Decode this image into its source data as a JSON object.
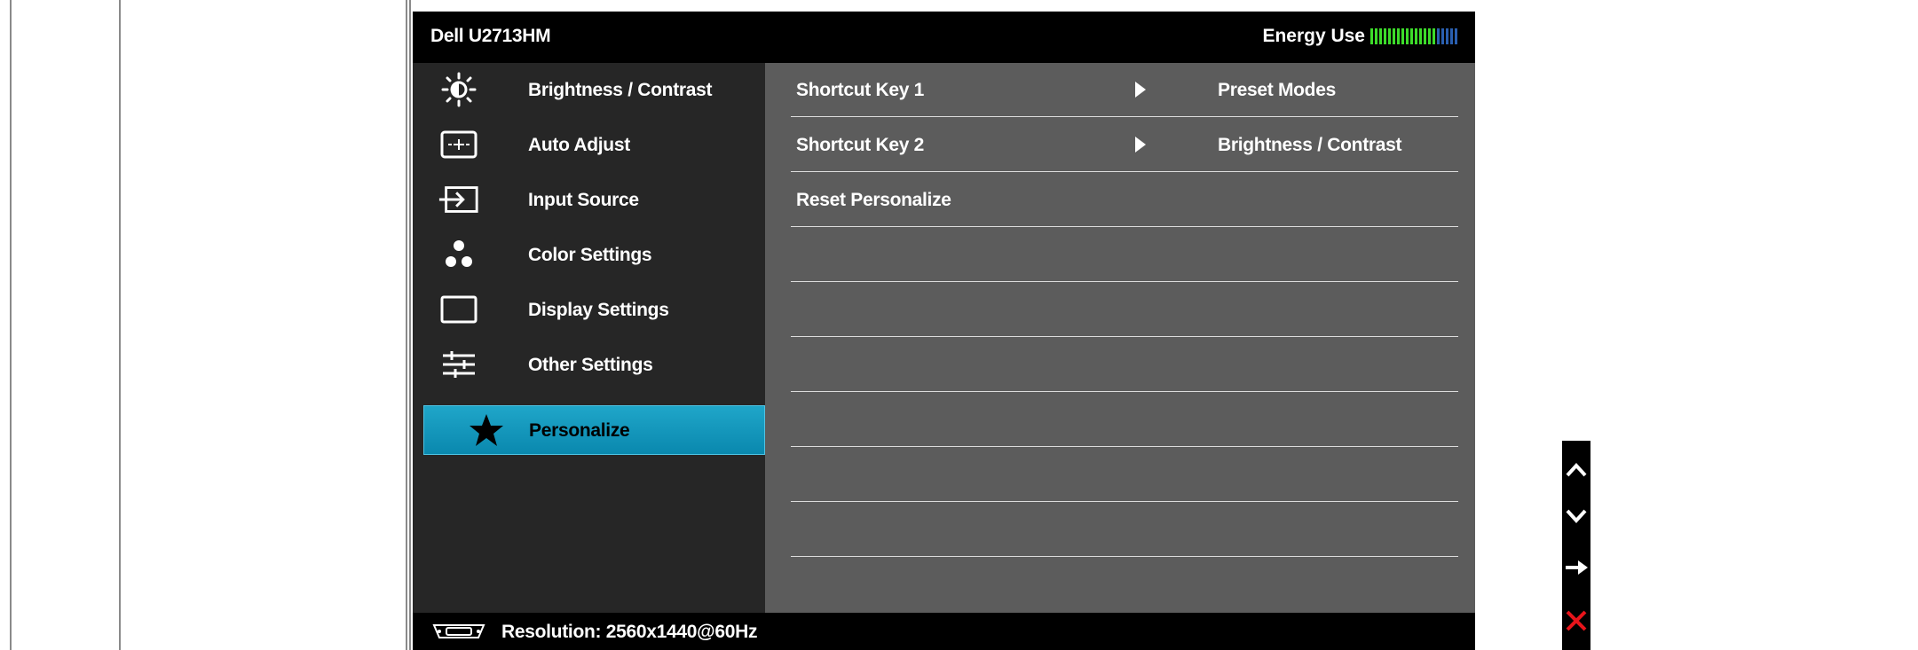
{
  "osd": {
    "title": "Dell U2713HM",
    "energy_label": "Energy Use",
    "energy_level": 0.75,
    "energy_segments_total": 20,
    "colors": {
      "accent": "#0a9ac2",
      "energy_on": "#3ddc2a",
      "energy_off": "#2a5fb0"
    }
  },
  "menu": {
    "items": [
      {
        "label": "Brightness / Contrast",
        "icon": "brightness-icon",
        "selected": false
      },
      {
        "label": "Auto Adjust",
        "icon": "auto-adjust-icon",
        "selected": false
      },
      {
        "label": "Input Source",
        "icon": "input-source-icon",
        "selected": false
      },
      {
        "label": "Color Settings",
        "icon": "color-settings-icon",
        "selected": false
      },
      {
        "label": "Display Settings",
        "icon": "display-settings-icon",
        "selected": false
      },
      {
        "label": "Other Settings",
        "icon": "other-settings-icon",
        "selected": false
      },
      {
        "label": "Personalize",
        "icon": "star-icon",
        "selected": true
      }
    ]
  },
  "submenu": {
    "rows": [
      {
        "name": "Shortcut Key 1",
        "value": "Preset Modes"
      },
      {
        "name": "Shortcut Key 2",
        "value": "Brightness / Contrast"
      },
      {
        "name": "Reset Personalize",
        "value": ""
      }
    ]
  },
  "footer": {
    "resolution": "Resolution: 2560x1440@60Hz",
    "icon": "vga-connector-icon"
  },
  "buttons": [
    {
      "icon": "chevron-up-icon"
    },
    {
      "icon": "chevron-down-icon"
    },
    {
      "icon": "arrow-right-icon"
    },
    {
      "icon": "close-icon"
    }
  ]
}
